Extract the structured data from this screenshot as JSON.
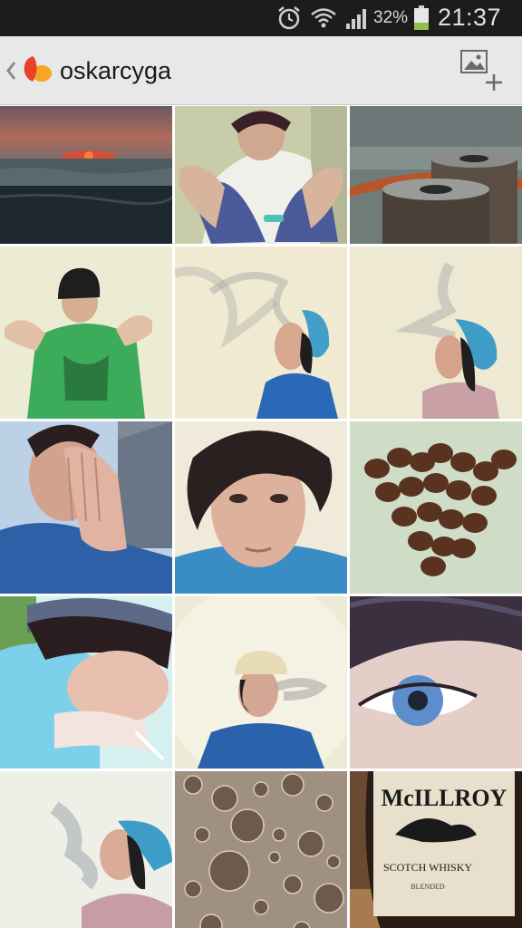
{
  "status_bar": {
    "battery_percent": "32%",
    "time": "21:37",
    "icons": [
      "alarm-icon",
      "wifi-icon",
      "signal-icon",
      "battery-icon"
    ]
  },
  "action_bar": {
    "title": "oskarcyga",
    "icons": [
      "back-chevron-icon",
      "app-logo-icon",
      "add-photo-icon"
    ]
  },
  "photos": [
    {
      "subject": "sunset over sea"
    },
    {
      "subject": "boy sitting"
    },
    {
      "subject": "mooring bollard with rope"
    },
    {
      "subject": "boy in beanie green shirt"
    },
    {
      "subject": "boy blowing smoke upward"
    },
    {
      "subject": "boy blowing smoke"
    },
    {
      "subject": "boy covering face with hands"
    },
    {
      "subject": "boy close-up portrait"
    },
    {
      "subject": "coffee beans heart"
    },
    {
      "subject": "boy with cigarette"
    },
    {
      "subject": "boy blowing smoke cap"
    },
    {
      "subject": "blue eye close-up"
    },
    {
      "subject": "boy blowing smoke cap side"
    },
    {
      "subject": "bubbles"
    },
    {
      "subject": "whisky bottle",
      "label_text": "MCILLROY SCOTCH WHISKY"
    }
  ]
}
